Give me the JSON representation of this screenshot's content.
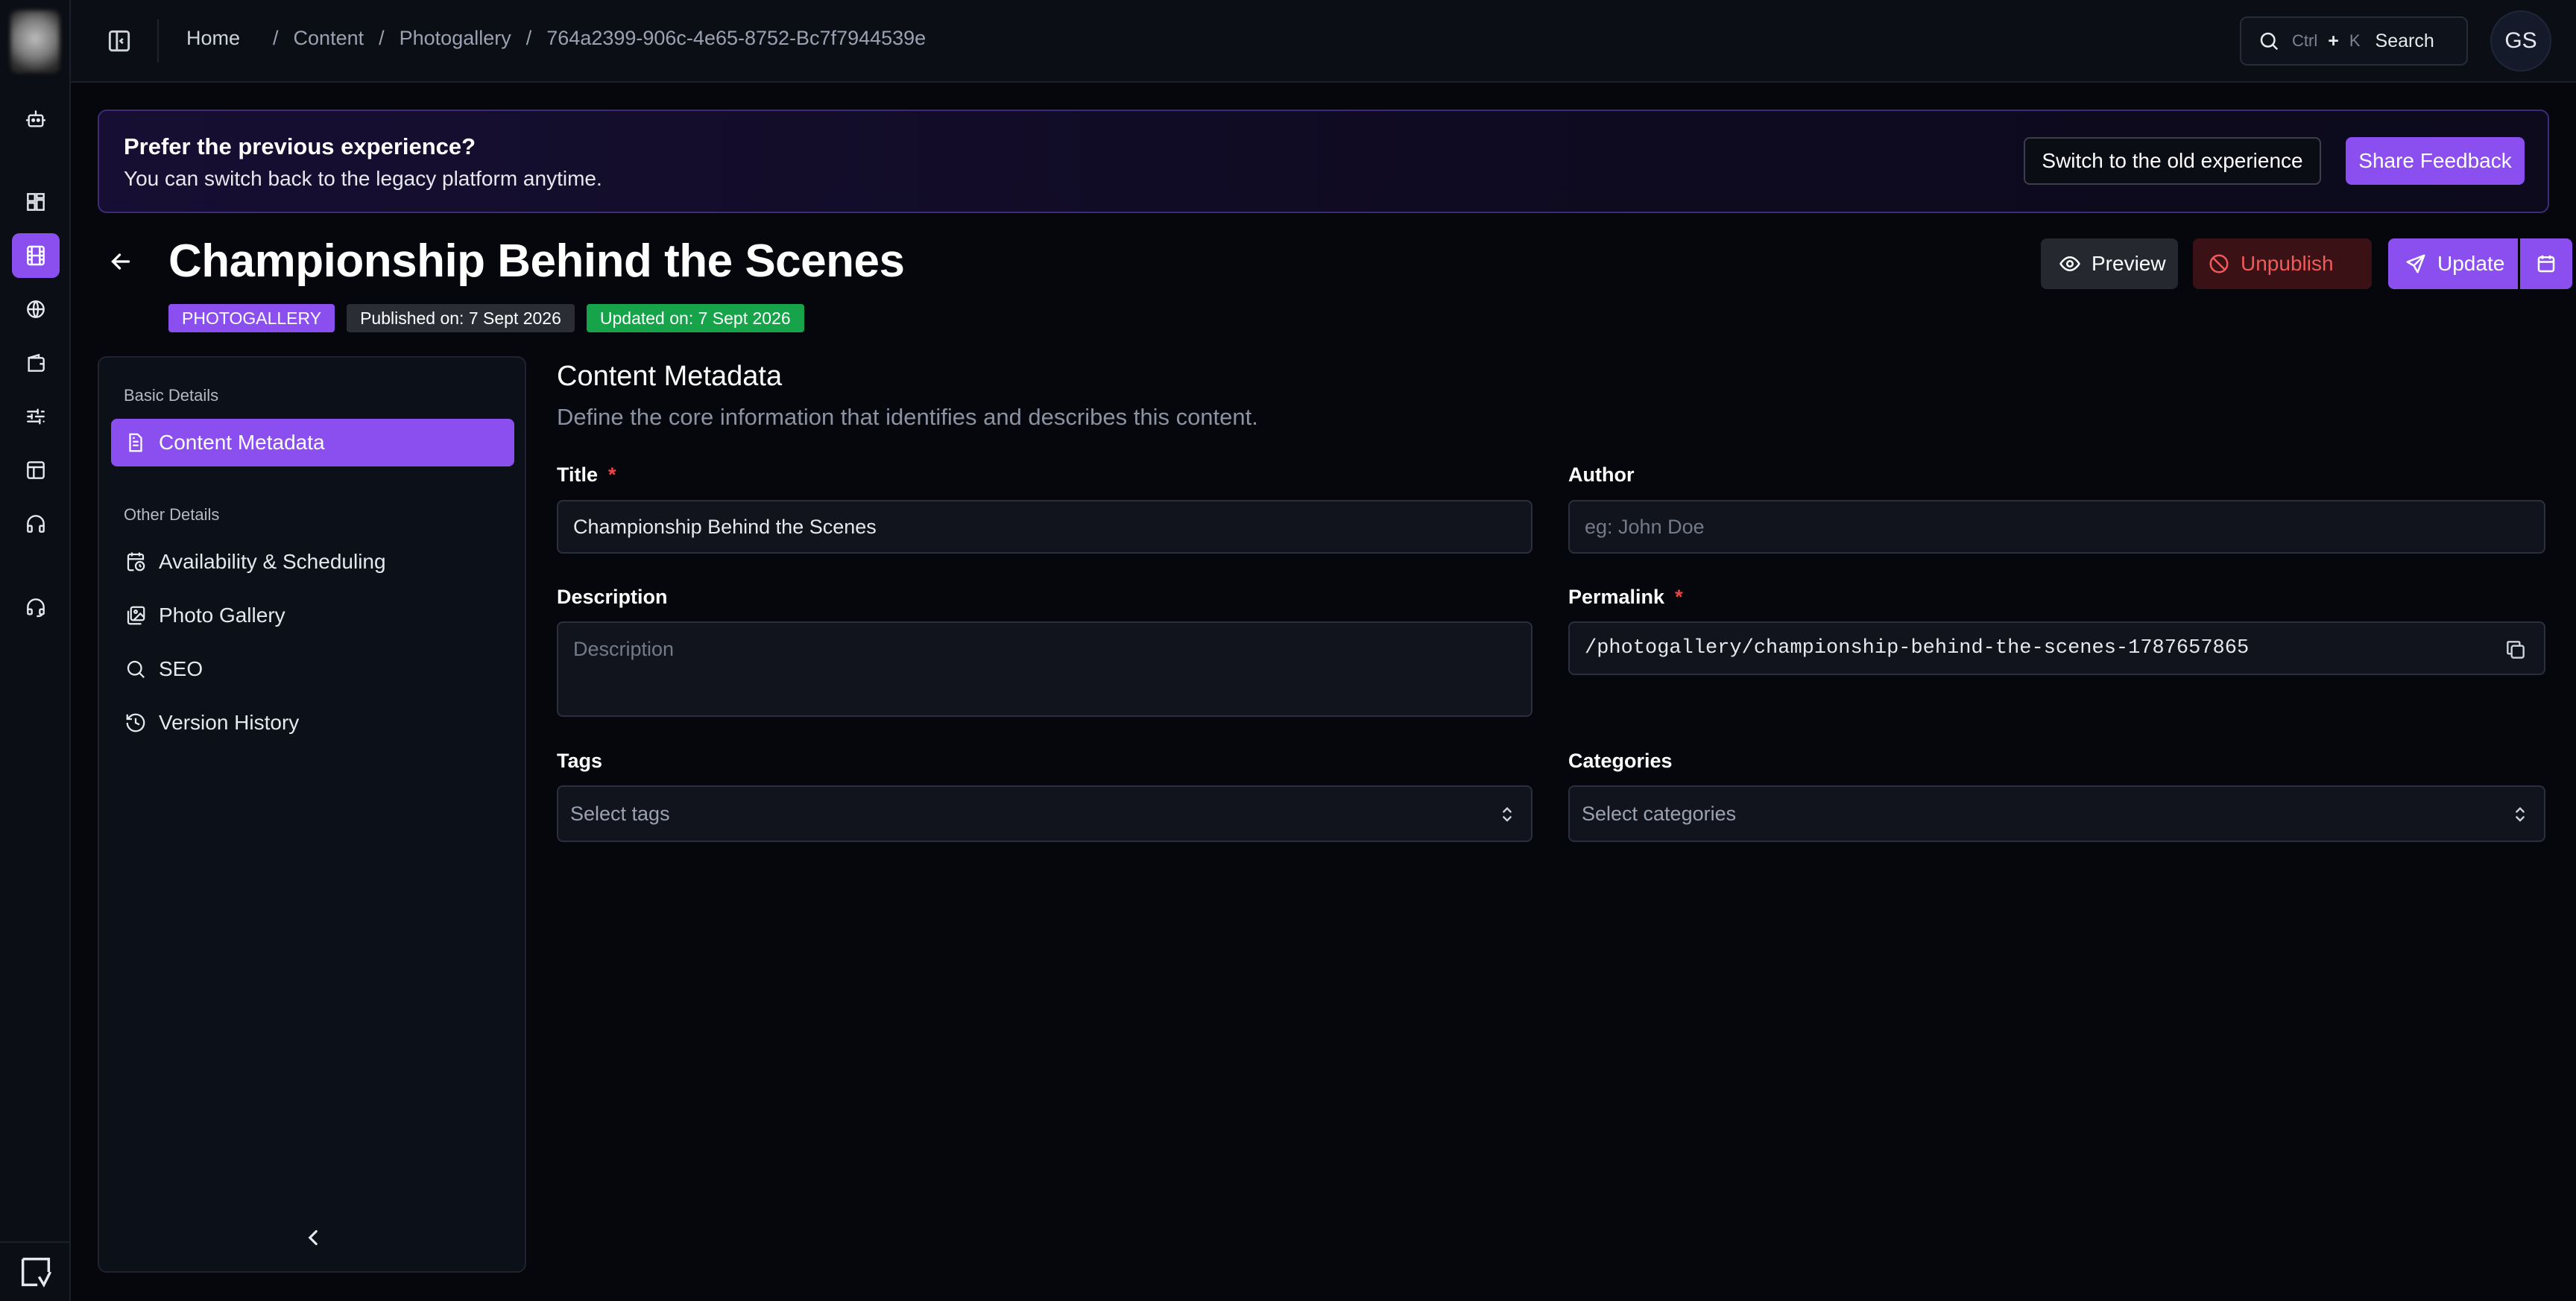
{
  "breadcrumb": {
    "home": "Home",
    "content": "Content",
    "photogallery": "Photogallery",
    "id": "764a2399-906c-4e65-8752-Bc7f7944539e"
  },
  "search": {
    "key1": "Ctrl",
    "plus": "+",
    "key2": "K",
    "label": "Search"
  },
  "user": {
    "initials": "GS"
  },
  "banner": {
    "title": "Prefer the previous experience?",
    "text": "You can switch back to the legacy platform anytime.",
    "switch_label": "Switch to the old experience",
    "feedback_label": "Share Feedback"
  },
  "page": {
    "title": "Championship Behind the Scenes",
    "type_badge": "PHOTOGALLERY",
    "published": "Published on: 7 Sept 2026",
    "updated": "Updated on: 7 Sept 2026"
  },
  "actions": {
    "preview": "Preview",
    "unpublish": "Unpublish",
    "update": "Update"
  },
  "sidebar": {
    "basic_heading": "Basic Details",
    "basic_items": [
      {
        "label": "Content Metadata",
        "icon": "document-icon",
        "active": true
      }
    ],
    "other_heading": "Other Details",
    "other_items": [
      {
        "label": "Availability & Scheduling",
        "icon": "calendar-clock-icon"
      },
      {
        "label": "Photo Gallery",
        "icon": "images-icon"
      },
      {
        "label": "SEO",
        "icon": "search-icon"
      },
      {
        "label": "Version History",
        "icon": "history-icon"
      }
    ]
  },
  "form": {
    "title": "Content Metadata",
    "subtitle": "Define the core information that identifies and describes this content.",
    "title_label": "Title",
    "title_value": "Championship Behind the Scenes",
    "author_label": "Author",
    "author_placeholder": "eg: John Doe",
    "description_label": "Description",
    "description_placeholder": "Description",
    "permalink_label": "Permalink",
    "permalink_value": "/photogallery/championship-behind-the-scenes-1787657865",
    "tags_label": "Tags",
    "tags_placeholder": "Select tags",
    "categories_label": "Categories",
    "categories_placeholder": "Select categories",
    "required_mark": "*"
  },
  "colors": {
    "accent": "#8b4ff0",
    "success": "#16a34a",
    "danger": "#ef5b5b",
    "background": "#05070c"
  }
}
